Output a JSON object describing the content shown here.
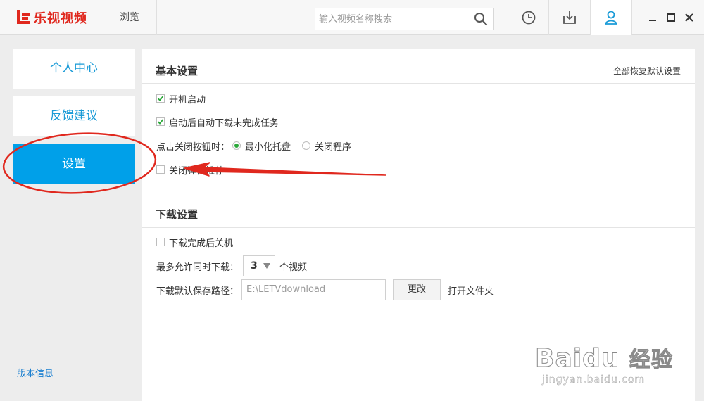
{
  "app": {
    "title": "乐视视频",
    "nav_browse": "浏览"
  },
  "search": {
    "placeholder": "输入视频名称搜索"
  },
  "toolbar": {
    "icons": [
      "history-icon",
      "download-icon",
      "user-icon"
    ]
  },
  "sidebar": {
    "items": [
      {
        "label": "个人中心"
      },
      {
        "label": "反馈建议"
      },
      {
        "label": "设置"
      }
    ],
    "version_link": "版本信息"
  },
  "basic_settings": {
    "title": "基本设置",
    "restore_defaults": "全部恢复默认设置",
    "autostart": {
      "label": "开机启动",
      "checked": true
    },
    "auto_download": {
      "label": "启动后自动下载未完成任务",
      "checked": true
    },
    "close_action": {
      "label": "点击关闭按钮时：",
      "options": [
        {
          "label": "最小化托盘",
          "selected": true
        },
        {
          "label": "关闭程序",
          "selected": false
        }
      ]
    },
    "close_popup_recommend": {
      "label": "关闭弹窗推荐",
      "checked": false
    }
  },
  "download_settings": {
    "title": "下载设置",
    "shutdown_after": {
      "label": "下载完成后关机",
      "checked": false
    },
    "max_concurrent": {
      "label": "最多允许同时下载：",
      "value": "3",
      "unit": "个视频"
    },
    "save_path": {
      "label": "下载默认保存路径：",
      "value": "E:\\LETVdownload"
    },
    "change_button": "更改",
    "open_folder": "打开文件夹"
  },
  "watermark": {
    "brand": "Bai",
    "brand2": "du",
    "cn": "经验",
    "url": "jingyan.baidu.com"
  },
  "colors": {
    "accent": "#00a0e9",
    "brand_red": "#e0281e",
    "annotation_red": "#e0281e",
    "radio_green": "#2ba83a"
  }
}
